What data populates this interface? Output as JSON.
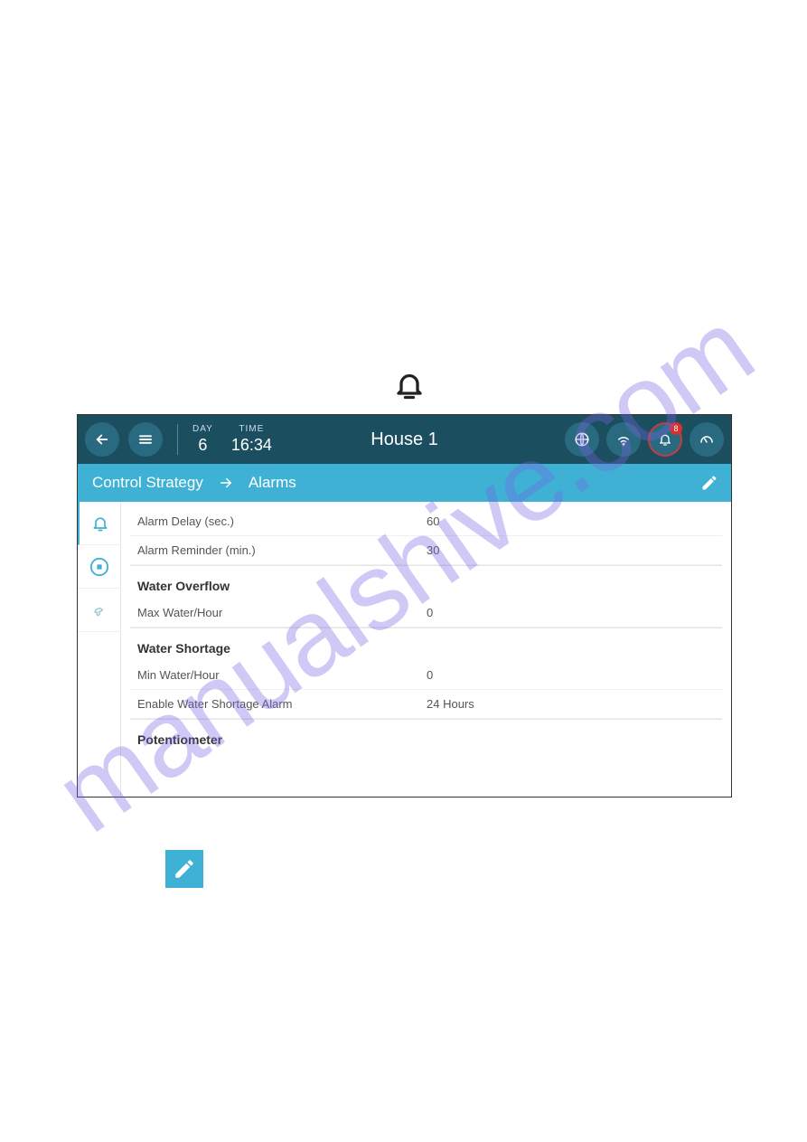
{
  "watermark": "manualshive.com",
  "topbar": {
    "day_label": "DAY",
    "day_value": "6",
    "time_label": "TIME",
    "time_value": "16:34",
    "title": "House 1",
    "alert_count": "8"
  },
  "breadcrumb": {
    "root": "Control Strategy",
    "current": "Alarms"
  },
  "settings": {
    "alarm_delay_label": "Alarm Delay (sec.)",
    "alarm_delay_value": "60",
    "alarm_reminder_label": "Alarm Reminder (min.)",
    "alarm_reminder_value": "30",
    "water_overflow_header": "Water Overflow",
    "max_water_label": "Max Water/Hour",
    "max_water_value": "0",
    "water_shortage_header": "Water Shortage",
    "min_water_label": "Min Water/Hour",
    "min_water_value": "0",
    "enable_shortage_label": "Enable Water Shortage Alarm",
    "enable_shortage_value": "24 Hours",
    "potentiometer_header": "Potentiometer"
  }
}
